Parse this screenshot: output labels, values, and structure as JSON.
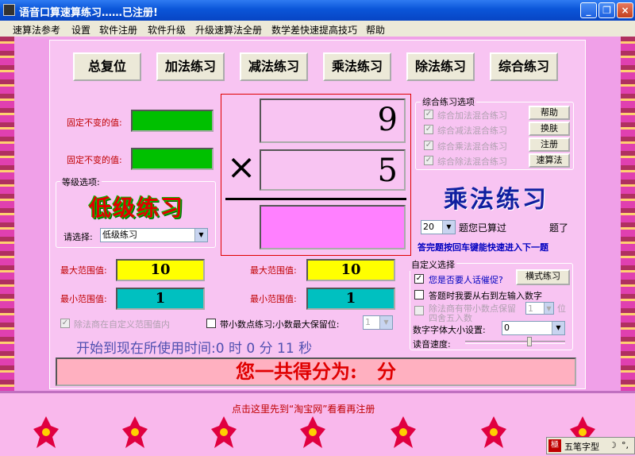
{
  "window": {
    "title": "语音口算速算练习……已注册!",
    "min": "_",
    "max": "❐",
    "close": "×"
  },
  "menu": [
    "速算法参考",
    "设置",
    "软件注册",
    "软件升级",
    "升级速算法全册",
    "数学差快速提高技巧",
    "帮助"
  ],
  "buttons": [
    "总复位",
    "加法练习",
    "减法练习",
    "乘法练习",
    "除法练习",
    "综合练习"
  ],
  "fixed": {
    "label1": "固定不变的值:",
    "label2": "固定不变的值:"
  },
  "level": {
    "group": "等级选项:",
    "banner": "低级练习",
    "select_label": "请选择:",
    "select_value": "低级练习"
  },
  "equation": {
    "a": "9",
    "op": "×",
    "b": "5",
    "answer": ""
  },
  "combo_opts": {
    "title": "综合练习选项",
    "items": [
      "综合加法混合练习",
      "综合减法混合练习",
      "综合乘法混合练习",
      "综合除法混合练习"
    ],
    "buttons": [
      "帮助",
      "换肤",
      "注册",
      "速算法"
    ]
  },
  "mode_title": "乘法练习",
  "count": {
    "value": "20",
    "label": "题您已算过",
    "unit": "题了"
  },
  "hint": "答完题按回车键能快速进入下一题",
  "range_left": {
    "max_label": "最大范围值:",
    "max": "10",
    "min_label": "最小范围值:",
    "min": "1"
  },
  "range_right": {
    "max_label": "最大范围值:",
    "max": "10",
    "min_label": "最小范围值:",
    "min": "1"
  },
  "options": {
    "div_custom": "除法商在自定义范围值内",
    "decimal": "带小数点练习;小数最大保留位:",
    "decimal_value": "1"
  },
  "custom": {
    "title": "自定义选择",
    "urge": "您是否要人话催促?",
    "style_btn": "横式练习",
    "rtl": "答题时我要从右到左输入数字",
    "round1": "除法商有带小数点保留",
    "round_val": "1",
    "round2": "位",
    "round3": "四舍五入数",
    "font_label": "数字字体大小设置:",
    "font_value": "0",
    "speed_label": "读音速度:"
  },
  "time": {
    "prefix": "开始到现在所使用时间:",
    "h": "0",
    "h_unit": "时",
    "m": "0",
    "m_unit": "分",
    "s": "11",
    "s_unit": "秒"
  },
  "score": {
    "prefix": "您一共得分为:",
    "value": "",
    "unit": "分"
  },
  "footer": "点击这里先到“淘宝网”看看再注册",
  "ime": {
    "name": "五笔字型",
    "icon": "極"
  },
  "colors": {
    "title_bar": "#0a55d8",
    "green": "#00c000",
    "yellow": "#ffff00",
    "teal": "#00c0c0",
    "answer": "#ff80ff"
  }
}
